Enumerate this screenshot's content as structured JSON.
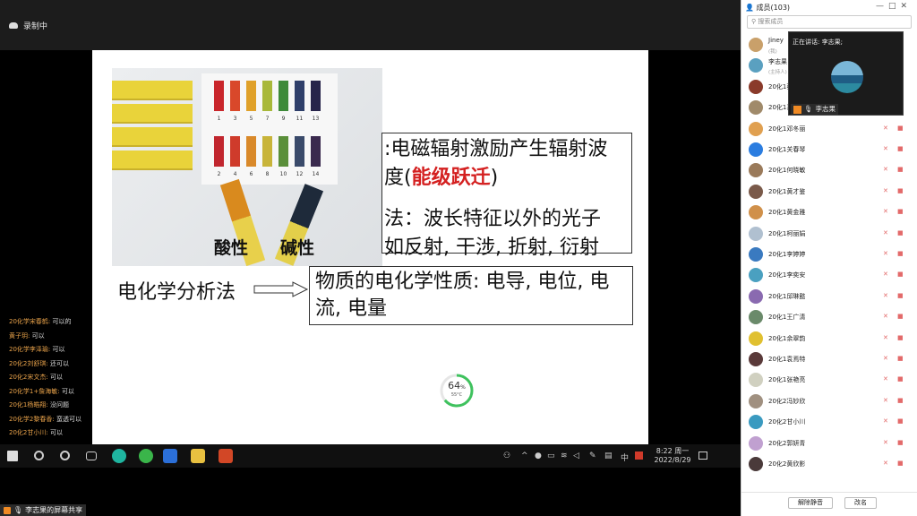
{
  "recording": {
    "label": "录制中"
  },
  "slide": {
    "box1_line1": ":电磁辐射激励产生辐射波",
    "box1_line2_a": "度(",
    "box1_line2_red": "能级跃迁",
    "box1_line2_b": ")",
    "box1_line3": "法：波长特征以外的光子",
    "box1_line4": "如反射, 干涉, 折射, 衍射",
    "echem_label": "电化学分析法",
    "box2_text": "物质的电化学性质: 电导, 电位, 电流, 电量",
    "photo": {
      "acid_label": "酸性",
      "base_label": "碱性",
      "row1_numbers": [
        "1",
        "3",
        "5",
        "7",
        "9",
        "11",
        "13"
      ],
      "row2_numbers": [
        "2",
        "4",
        "6",
        "8",
        "10",
        "12",
        "14"
      ],
      "row1_colors": [
        "#c9262b",
        "#d9482a",
        "#e0a12a",
        "#a8b83a",
        "#3e8a3a",
        "#2f3f6a",
        "#27244a"
      ],
      "row2_colors": [
        "#c1262e",
        "#cf3b2b",
        "#d9892a",
        "#c8b43a",
        "#5a8f3a",
        "#3a4a6a",
        "#3a2a4e"
      ]
    }
  },
  "gauge": {
    "percent": "64",
    "percent_unit": "%",
    "temp": "55°C",
    "fraction": 0.64
  },
  "taskbar": {
    "time": "8:22 周一",
    "date": "2022/8/29",
    "ime": "中"
  },
  "chat": [
    {
      "name": "20化学宋春鹤:",
      "msg": "可以的"
    },
    {
      "name": "黄子玥:",
      "msg": "可以"
    },
    {
      "name": "20化学李泽瑜:",
      "msg": "可以"
    },
    {
      "name": "20化2刘舒琪:",
      "msg": "还可以"
    },
    {
      "name": "20化2宋文杰:",
      "msg": "可以"
    },
    {
      "name": "20化学1+詹海敏:",
      "msg": "可以"
    },
    {
      "name": "20化1杨皓翔:",
      "msg": "没问题"
    },
    {
      "name": "20化学2黎春香:",
      "msg": "蛮透可以"
    },
    {
      "name": "20化2甘小川:",
      "msg": "可以"
    }
  ],
  "share_label": "李志果的屏幕共享",
  "panel": {
    "title": "成员(103)",
    "search_placeholder": "搜索成员",
    "unmute_all": "解除静音",
    "rename": "改名",
    "members": [
      {
        "name": "Jiney",
        "sub": "(我)",
        "color": "#c9a06a"
      },
      {
        "name": "李志果",
        "sub": "(主持人)",
        "color": "#5aa0c0"
      },
      {
        "name": "20化1蔡",
        "sub": "",
        "color": "#8a3a2a"
      },
      {
        "name": "20化1喜",
        "sub": "",
        "color": "#a08a6a"
      },
      {
        "name": "20化1邓冬丽",
        "sub": "",
        "color": "#e0a050"
      },
      {
        "name": "20化1关春琴",
        "sub": "",
        "color": "#2b7de0"
      },
      {
        "name": "20化1何晓敏",
        "sub": "",
        "color": "#9a7a5a"
      },
      {
        "name": "20化1黄才鉴",
        "sub": "",
        "color": "#7a5a4a"
      },
      {
        "name": "20化1黄金雅",
        "sub": "",
        "color": "#d0904a"
      },
      {
        "name": "20化1柯丽娟",
        "sub": "",
        "color": "#b0c0d0"
      },
      {
        "name": "20化1李婷婷",
        "sub": "",
        "color": "#3a7ac0"
      },
      {
        "name": "20化1李奕安",
        "sub": "",
        "color": "#4aa0c0"
      },
      {
        "name": "20化1邱琳懿",
        "sub": "",
        "color": "#8a6ab0"
      },
      {
        "name": "20化1王广清",
        "sub": "",
        "color": "#6a8a6a"
      },
      {
        "name": "20化1余翠韵",
        "sub": "",
        "color": "#e0c030"
      },
      {
        "name": "20化1袁焉特",
        "sub": "",
        "color": "#5a3a3a"
      },
      {
        "name": "20化1张艳亮",
        "sub": "",
        "color": "#d0d0c0"
      },
      {
        "name": "20化2冯妙欣",
        "sub": "",
        "color": "#a09080"
      },
      {
        "name": "20化2甘小川",
        "sub": "",
        "color": "#3a9ac0"
      },
      {
        "name": "20化2郭妍青",
        "sub": "",
        "color": "#c0a0d0"
      },
      {
        "name": "20化2黄欣影",
        "sub": "",
        "color": "#4a3a3a"
      }
    ],
    "mic_muted_glyph": "✕",
    "cam_label": "■"
  },
  "popup": {
    "header": "正在讲话: 李志果;",
    "speaker": "李志果"
  }
}
